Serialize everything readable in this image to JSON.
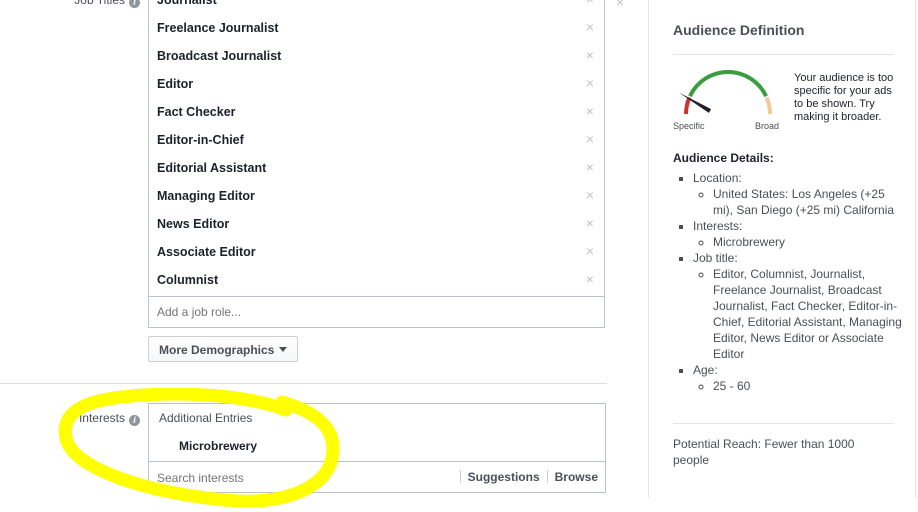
{
  "job_titles": {
    "label": "Job Titles",
    "items": [
      "Journalist",
      "Freelance Journalist",
      "Broadcast Journalist",
      "Editor",
      "Fact Checker",
      "Editor-in-Chief",
      "Editorial Assistant",
      "Managing Editor",
      "News Editor",
      "Associate Editor",
      "Columnist"
    ],
    "remove_glyph": "×",
    "add_placeholder": "Add a job role..."
  },
  "more_demographics": {
    "label": "More Demographics"
  },
  "interests": {
    "label": "Interests",
    "group_heading": "Additional Entries",
    "items": [
      "Microbrewery"
    ],
    "search_placeholder": "Search interests",
    "suggestions_label": "Suggestions",
    "browse_label": "Browse"
  },
  "annotation": {
    "color": "#ffff00"
  },
  "audience_panel": {
    "title": "Audience Definition",
    "gauge": {
      "left_label": "Specific",
      "right_label": "Broad",
      "value_fraction": 0.05,
      "colors": {
        "specific": "#d0312d",
        "mid": "#3a9d3f",
        "broad": "#f6c796",
        "needle": "#1d2129"
      }
    },
    "gauge_message": "Your audience is too specific for your ads to be shown. Try making it broader.",
    "details_title": "Audience Details:",
    "details": [
      {
        "label": "Location:",
        "value": "United States: Los Angeles (+25 mi), San Diego (+25 mi) California"
      },
      {
        "label": "Interests:",
        "value": "Microbrewery"
      },
      {
        "label": "Job title:",
        "value": "Editor, Columnist, Journalist, Freelance Journalist, Broadcast Journalist, Fact Checker, Editor-in-Chief, Editorial Assistant, Managing Editor, News Editor or Associate Editor"
      },
      {
        "label": "Age:",
        "value": "25 - 60"
      }
    ],
    "potential_reach": "Potential Reach: Fewer than 1000 people"
  }
}
